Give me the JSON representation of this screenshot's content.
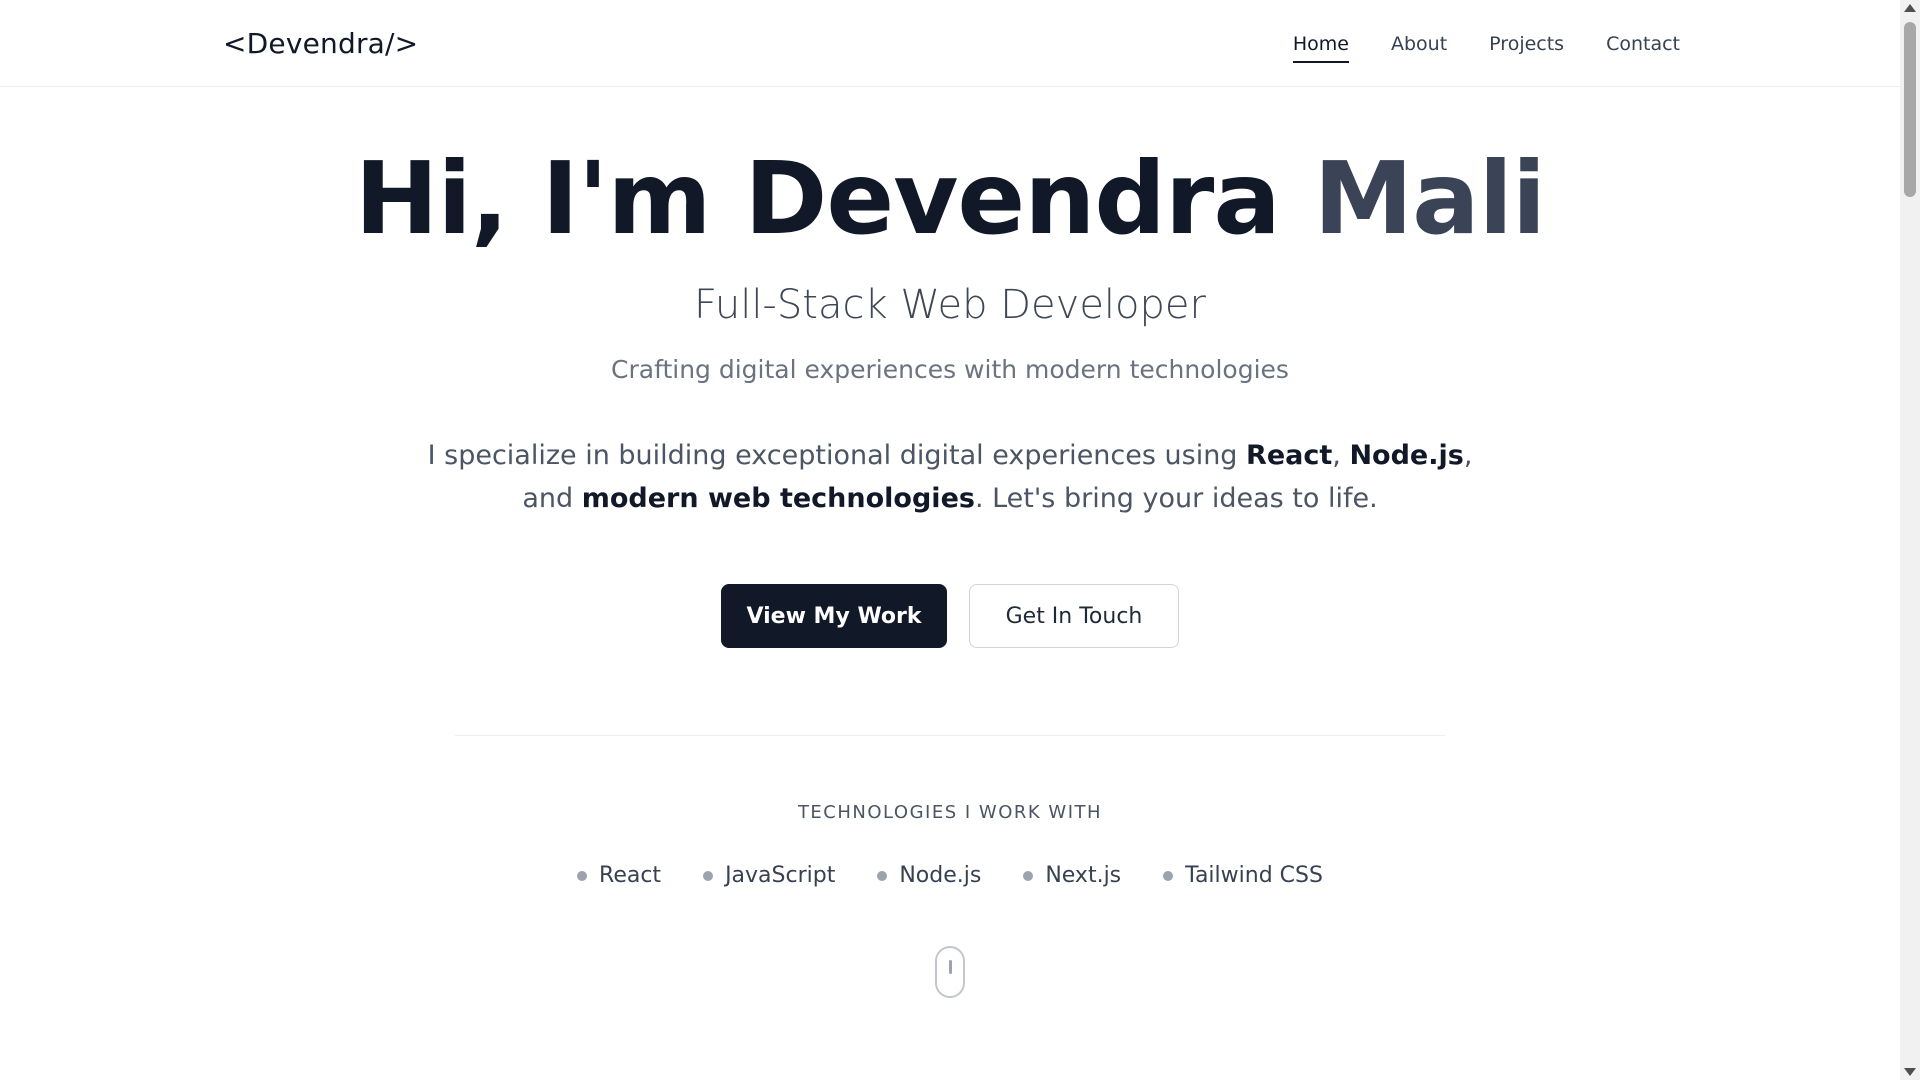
{
  "header": {
    "logo": "<Devendra/>",
    "nav": [
      {
        "label": "Home",
        "active": true
      },
      {
        "label": "About",
        "active": false
      },
      {
        "label": "Projects",
        "active": false
      },
      {
        "label": "Contact",
        "active": false
      }
    ]
  },
  "hero": {
    "greeting": "Hi, I'm Devendra",
    "last_name": "Mali",
    "subtitle": "Full-Stack Web Developer",
    "tagline": "Crafting digital experiences with modern technologies",
    "bio": {
      "part1": "I specialize in building exceptional digital experiences using ",
      "strong1": "React",
      "sep1": ", ",
      "strong2": "Node.js",
      "sep2": ",",
      "part2": "and ",
      "strong3": "modern web technologies",
      "part3": ". Let's bring your ideas to life."
    },
    "buttons": {
      "primary": "View My Work",
      "secondary": "Get In Touch"
    }
  },
  "technologies": {
    "heading": "TECHNOLOGIES I WORK WITH",
    "items": [
      "React",
      "JavaScript",
      "Node.js",
      "Next.js",
      "Tailwind CSS"
    ]
  },
  "icons": {
    "scroll_indicator": "mouse-icon",
    "tech_bullet": "dot-icon"
  },
  "colors": {
    "primary": "#111827",
    "accent_name": "#3a4456",
    "muted": "#6b7280"
  }
}
